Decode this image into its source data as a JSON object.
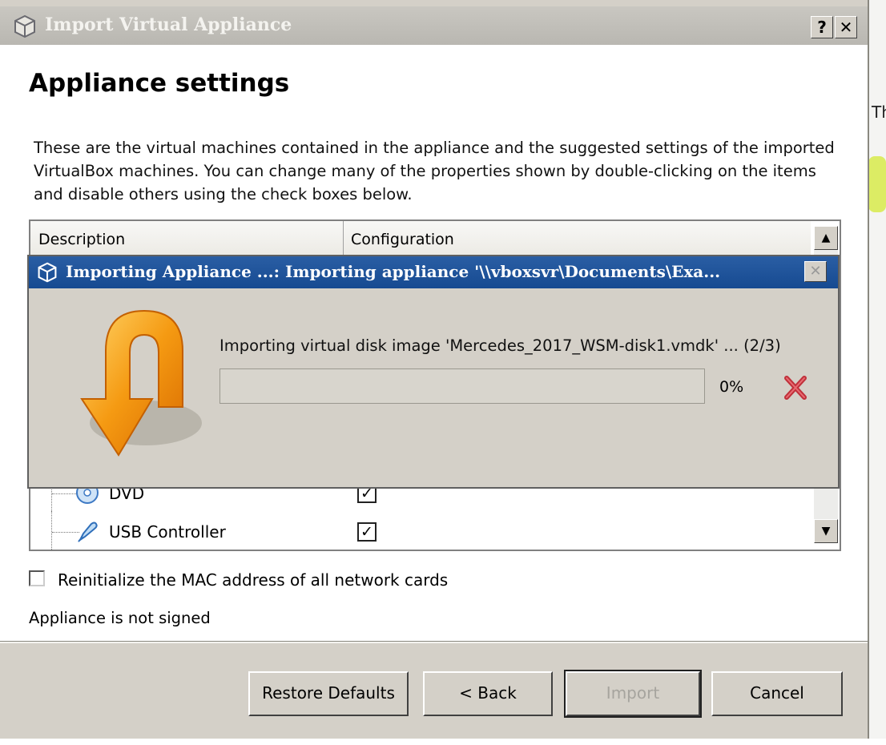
{
  "window": {
    "title": "Import Virtual Appliance",
    "help_label": "?",
    "close_label": "✕"
  },
  "content": {
    "heading": "Appliance settings",
    "description": "These are the virtual machines contained in the appliance and the suggested settings of the imported VirtualBox machines. You can change many of the properties shown by double-clicking on the items and disable others using the check boxes below."
  },
  "table": {
    "columns": [
      "Description",
      "Configuration"
    ],
    "rows": [
      {
        "label": "DVD",
        "icon": "dvd-icon",
        "checked": true
      },
      {
        "label": "USB Controller",
        "icon": "usb-icon",
        "checked": true
      }
    ]
  },
  "options": {
    "mac_label": "Reinitialize the MAC address of all network cards",
    "mac_checked": false,
    "signed_text": "Appliance is not signed"
  },
  "buttons": {
    "restore": "Restore Defaults",
    "back": "< Back",
    "import": "Import",
    "cancel": "Cancel"
  },
  "progress": {
    "title": "Importing Appliance ...: Importing appliance '\\\\vboxsvr\\Documents\\Exa...",
    "message": "Importing virtual disk image 'Mercedes_2017_WSM-disk1.vmdk' ... (2/3)",
    "percent_label": "0%",
    "percent_value": 0
  },
  "desktop": {
    "edge_text": "Th"
  },
  "colors": {
    "titlebar_active": "#164a91",
    "dialog_bg": "#d4d0c8",
    "cancel_x": "#c0303a",
    "arrow_orange": "#f59a12"
  }
}
